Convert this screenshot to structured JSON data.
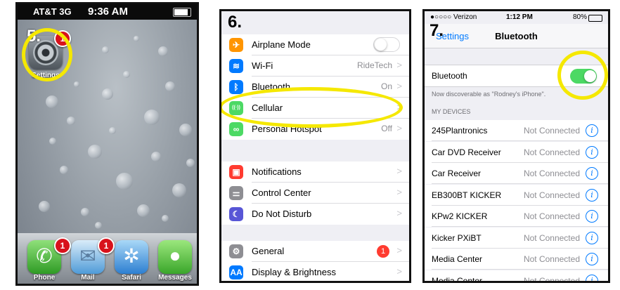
{
  "panel1": {
    "step": "5.",
    "status": {
      "carrier": "AT&T 3G",
      "time": "9:36 AM"
    },
    "settings_app": {
      "label": "Settings",
      "badge": "1"
    },
    "dock": [
      {
        "label": "Phone",
        "badge": "1",
        "icon": "phone-icon"
      },
      {
        "label": "Mail",
        "badge": "1",
        "icon": "mail-icon"
      },
      {
        "label": "Safari",
        "badge": "",
        "icon": "safari-icon"
      },
      {
        "label": "Messages",
        "badge": "",
        "icon": "messages-icon"
      }
    ],
    "highlight_color": "#f5e800"
  },
  "panel2": {
    "step": "6.",
    "groups": [
      [
        {
          "label": "Airplane Mode",
          "value": "",
          "icon": "airplane-icon",
          "color": "#ff9500",
          "toggle": "off"
        },
        {
          "label": "Wi-Fi",
          "value": "RideTech",
          "icon": "wifi-icon",
          "color": "#007aff"
        },
        {
          "label": "Bluetooth",
          "value": "On",
          "icon": "bluetooth-icon",
          "color": "#007aff"
        },
        {
          "label": "Cellular",
          "value": "",
          "icon": "cellular-icon",
          "color": "#4cd964"
        },
        {
          "label": "Personal Hotspot",
          "value": "Off",
          "icon": "hotspot-icon",
          "color": "#4cd964"
        }
      ],
      [
        {
          "label": "Notifications",
          "value": "",
          "icon": "notifications-icon",
          "color": "#ff3b30"
        },
        {
          "label": "Control Center",
          "value": "",
          "icon": "control-center-icon",
          "color": "#8e8e93"
        },
        {
          "label": "Do Not Disturb",
          "value": "",
          "icon": "moon-icon",
          "color": "#5856d6"
        }
      ],
      [
        {
          "label": "General",
          "value": "",
          "icon": "gear-icon",
          "color": "#8e8e93",
          "badge": "1"
        },
        {
          "label": "Display & Brightness",
          "value": "",
          "icon": "display-icon",
          "color": "#007aff"
        }
      ]
    ]
  },
  "panel3": {
    "step": "7.",
    "status": {
      "carrier": "●○○○○ Verizon",
      "time": "1:12 PM",
      "battery": "80%"
    },
    "nav": {
      "back": "Settings",
      "title": "Bluetooth"
    },
    "bluetooth_label": "Bluetooth",
    "discoverable": "Now discoverable as \"Rodney's iPhone\".",
    "section_header": "MY DEVICES",
    "devices": [
      {
        "name": "245Plantronics",
        "status": "Not Connected"
      },
      {
        "name": "Car DVD Receiver",
        "status": "Not Connected"
      },
      {
        "name": "Car Receiver",
        "status": "Not Connected"
      },
      {
        "name": "EB300BT KICKER",
        "status": "Not Connected"
      },
      {
        "name": "KPw2 KICKER",
        "status": "Not Connected"
      },
      {
        "name": "Kicker PXiBT",
        "status": "Not Connected"
      },
      {
        "name": "Media Center",
        "status": "Not Connected"
      },
      {
        "name": "Media Center",
        "status": "Not Connected"
      }
    ]
  }
}
